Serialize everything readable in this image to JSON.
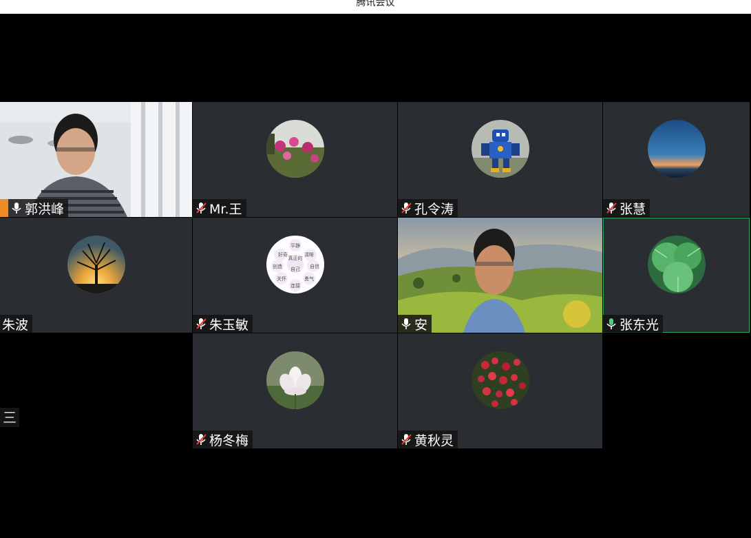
{
  "window": {
    "title": "腾讯会议"
  },
  "participants": [
    {
      "name": "郭洪峰",
      "mic": "on",
      "video": true,
      "host": true
    },
    {
      "name": "Mr.王",
      "mic": "muted",
      "avatar": "flower-garden-avatar"
    },
    {
      "name": "孔令涛",
      "mic": "muted",
      "avatar": "robot-toy-avatar"
    },
    {
      "name": "张慧",
      "mic": "muted",
      "avatar": "night-sky-avatar"
    },
    {
      "name": "朱波",
      "mic": "none",
      "avatar": "tree-sunset-avatar"
    },
    {
      "name": "朱玉敏",
      "mic": "muted",
      "avatar": "words-circle-avatar",
      "avatar_words": [
        "好奇",
        "平静",
        "清晰",
        "创造",
        "真正的",
        "自信",
        "自己",
        "关怀",
        "勇气",
        "连接"
      ]
    },
    {
      "name": "安",
      "mic": "on",
      "video": true
    },
    {
      "name": "张东光",
      "mic": "on",
      "avatar": "green-leaf-avatar",
      "active_speaker": true
    },
    {
      "name": "杨冬梅",
      "mic": "muted",
      "avatar": "lotus-avatar"
    },
    {
      "name": "黄秋灵",
      "mic": "muted",
      "avatar": "red-berries-avatar"
    }
  ],
  "side_menu_glyph": "三",
  "colors": {
    "tile_bg": "#2a2d31",
    "active_border": "#2fae6a",
    "host_badge": "#f08a23",
    "muted_slash": "#e03c3c"
  }
}
